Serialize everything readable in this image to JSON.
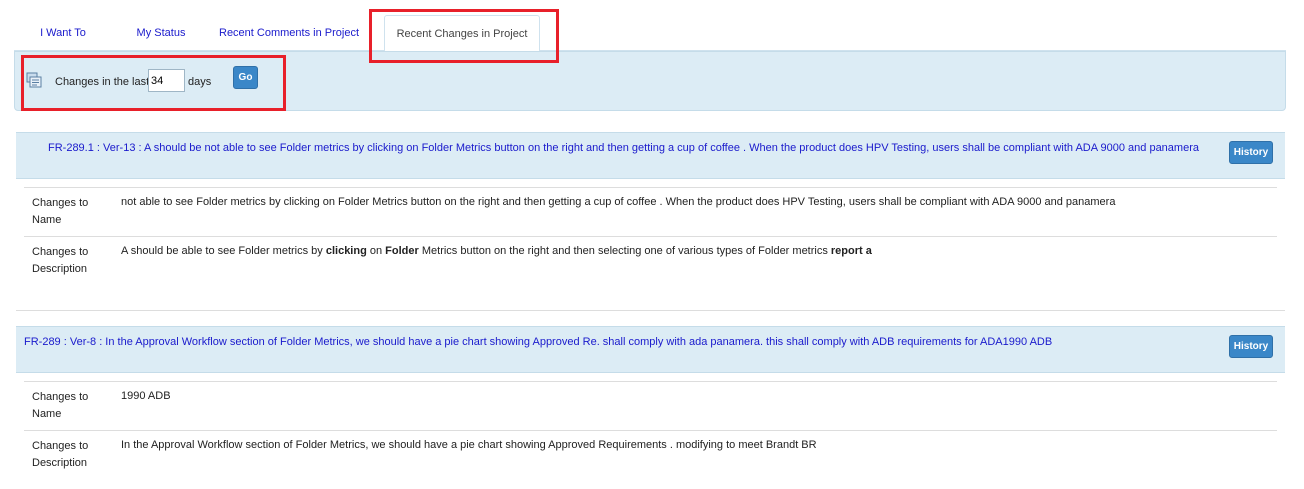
{
  "tabs": [
    {
      "label": "I Want To"
    },
    {
      "label": "My Status"
    },
    {
      "label": "Recent Comments in Project"
    },
    {
      "label": "Recent Changes in Project"
    }
  ],
  "filter": {
    "label": "Changes in the last",
    "days_value": "34",
    "suffix": "days",
    "go_label": "Go"
  },
  "entries": [
    {
      "title": "FR-289.1 : Ver-13 : A should be not able to see Folder metrics by clicking on Folder Metrics button on the right and then getting a cup of coffee . When the product does HPV Testing, users shall be compliant with ADA 9000 and panamera",
      "history_label": "History",
      "changes": [
        {
          "label": "Changes to Name",
          "value": "not able to see Folder metrics by clicking on Folder Metrics button on the right and then getting a cup of coffee . When the product does HPV Testing, users shall be compliant with ADA 9000 and panamera"
        },
        {
          "label": "Changes to Description",
          "value_parts": [
            "A should be able to see Folder metrics by ",
            "clicking",
            " on ",
            "Folder",
            " Metrics button on the right and then selecting one of various types of Folder metrics ",
            "report a"
          ]
        }
      ]
    },
    {
      "title": "FR-289 : Ver-8 : In the Approval Workflow section of Folder Metrics, we should have a pie chart showing Approved Re. shall comply with ada panamera. this shall comply with ADB requirements for ADA1990 ADB",
      "history_label": "History",
      "changes": [
        {
          "label": "Changes to Name",
          "value": "1990 ADB"
        },
        {
          "label": "Changes to Description",
          "value": "In the Approval Workflow section of Folder Metrics, we should have a pie chart showing Approved Requirements . modifying to meet Brandt BR"
        }
      ]
    }
  ],
  "colors": {
    "link": "#1a1acc",
    "panel_bg": "#dcecf5",
    "button_bg": "#3a87c8",
    "highlight": "#e8202a"
  }
}
